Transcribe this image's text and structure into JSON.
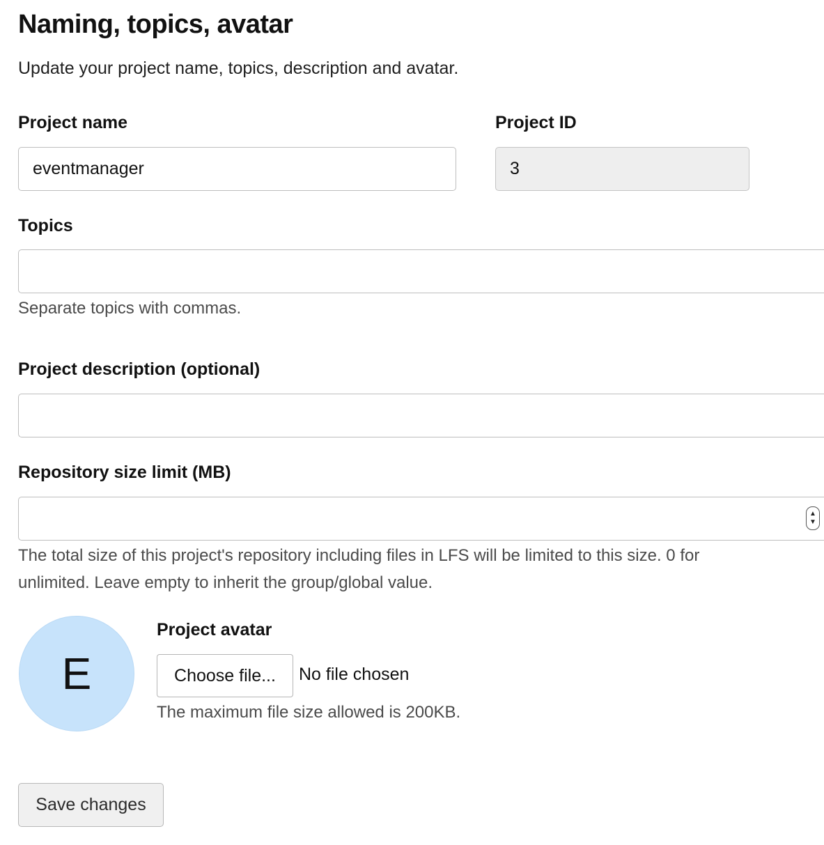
{
  "section": {
    "title": "Naming, topics, avatar",
    "subtitle": "Update your project name, topics, description and avatar."
  },
  "project_name": {
    "label": "Project name",
    "value": "eventmanager"
  },
  "project_id": {
    "label": "Project ID",
    "value": "3"
  },
  "topics": {
    "label": "Topics",
    "value": "",
    "help": "Separate topics with commas."
  },
  "description": {
    "label": "Project description (optional)",
    "value": ""
  },
  "repo_size": {
    "label": "Repository size limit (MB)",
    "value": "",
    "help_line1": "The total size of this project's repository including files in LFS will be limited to this size. 0 for",
    "help_line2": "unlimited. Leave empty to inherit the group/global value."
  },
  "avatar": {
    "initial": "E",
    "label": "Project avatar",
    "choose_button": "Choose file...",
    "file_status": "No file chosen",
    "help": "The maximum file size allowed is 200KB.",
    "color": "#c7e3fb"
  },
  "actions": {
    "save_label": "Save changes"
  }
}
